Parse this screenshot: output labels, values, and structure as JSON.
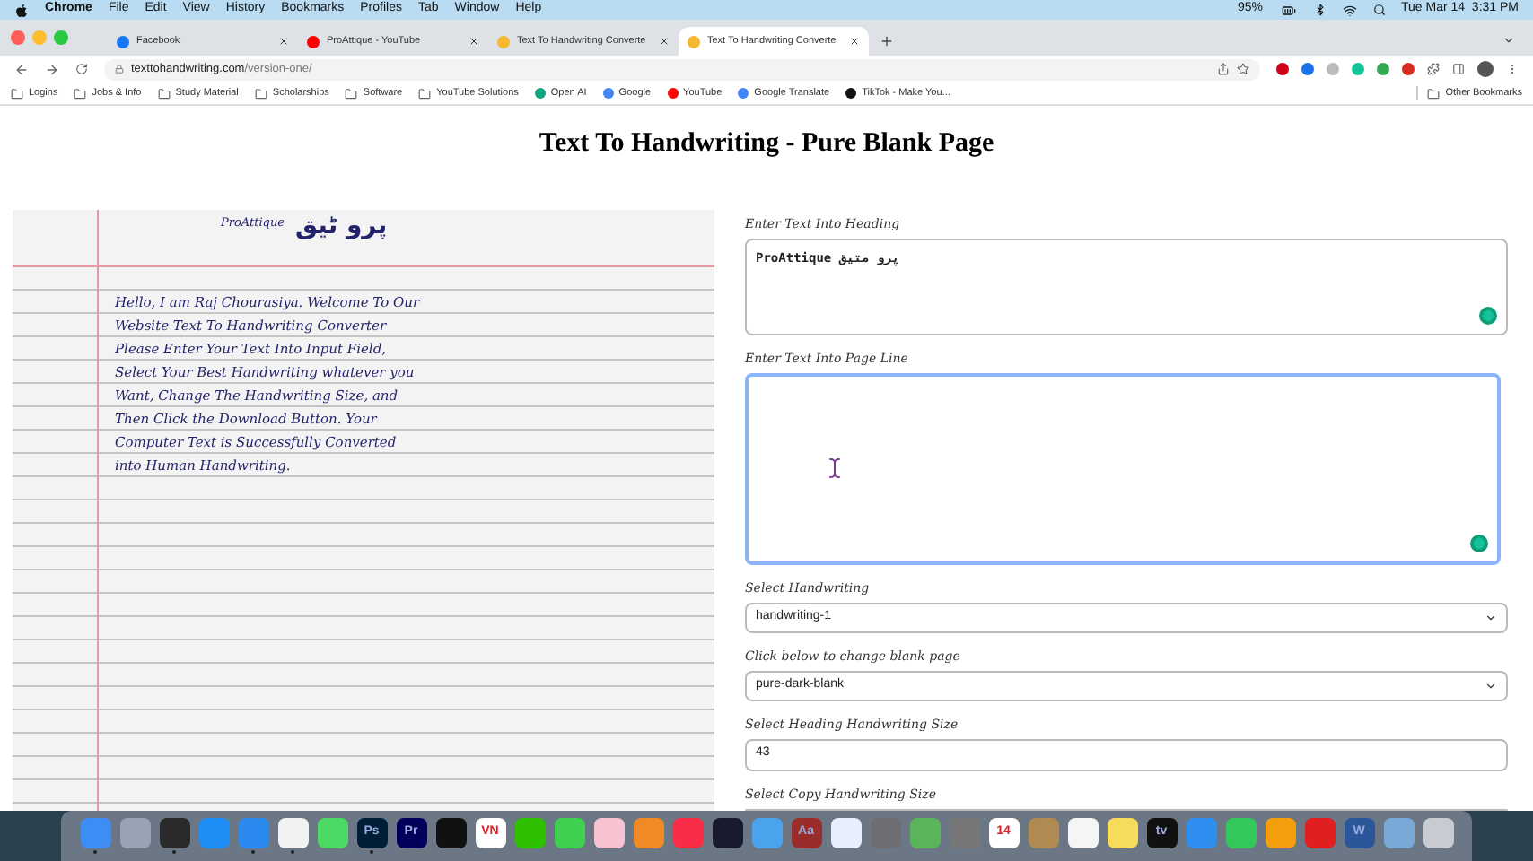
{
  "menu_bar": {
    "app": "Chrome",
    "items": [
      "File",
      "Edit",
      "View",
      "History",
      "Bookmarks",
      "Profiles",
      "Tab",
      "Window",
      "Help"
    ],
    "battery": "95%",
    "clock": "Tue Mar 14  3:31 PM"
  },
  "tabs": [
    {
      "title": "Facebook",
      "selected": false,
      "color": "#1877f2"
    },
    {
      "title": "ProAttique - YouTube",
      "selected": false,
      "color": "#ff0000"
    },
    {
      "title": "Text To Handwriting Converte",
      "selected": false,
      "color": "#f5b82e"
    },
    {
      "title": "Text To Handwriting Converte",
      "selected": true,
      "color": "#f5b82e"
    }
  ],
  "address": {
    "host": "texttohandwriting.com",
    "path": "/version-one/"
  },
  "bookmarks": [
    {
      "label": "Logins",
      "kind": "folder"
    },
    {
      "label": "Jobs & Info",
      "kind": "folder"
    },
    {
      "label": "Study Material",
      "kind": "folder"
    },
    {
      "label": "Scholarships",
      "kind": "folder"
    },
    {
      "label": "Software",
      "kind": "folder"
    },
    {
      "label": "YouTube Solutions",
      "kind": "folder"
    },
    {
      "label": "Open AI",
      "kind": "site",
      "color": "#10a37f"
    },
    {
      "label": "Google",
      "kind": "site",
      "color": "#4285f4"
    },
    {
      "label": "YouTube",
      "kind": "site",
      "color": "#ff0000"
    },
    {
      "label": "Google Translate",
      "kind": "site",
      "color": "#4285f4"
    },
    {
      "label": "TikTok - Make You...",
      "kind": "site",
      "color": "#111111"
    }
  ],
  "other_bookmarks": "Other Bookmarks",
  "page": {
    "heading": "Text To Handwriting - Pure Blank Page",
    "paper": {
      "heading_latin": "ProAttique",
      "heading_urdu": "پرو ٹیق",
      "lines": [
        "Hello, I am Raj Chourasiya. Welcome To Our",
        "Website Text To Handwriting Converter",
        "Please Enter Your Text Into Input Field,",
        "Select Your Best Handwriting whatever you",
        "Want, Change The Handwriting Size, and",
        "Then Click the Download Button. Your",
        "Computer Text is Successfully Converted",
        "into Human Handwriting."
      ]
    },
    "fields": [
      {
        "label": "Enter Text Into Heading",
        "kind": "textarea",
        "value": "ProAttique پرو متیق",
        "focused": false
      },
      {
        "label": "Enter Text Into Page Line",
        "kind": "textarea",
        "focused": true
      },
      {
        "label": "Select Handwriting",
        "kind": "select",
        "value": "handwriting-1"
      },
      {
        "label": "Click below to change blank page",
        "kind": "select",
        "value": "pure-dark-blank"
      },
      {
        "label": "Select Heading Handwriting Size",
        "kind": "input",
        "value": "43"
      },
      {
        "label": "Select Copy Handwriting Size",
        "kind": "input"
      }
    ]
  },
  "dock": [
    {
      "color": "#3d8df5",
      "running": true
    },
    {
      "color": "#9aa3b5",
      "running": false
    },
    {
      "color": "#2a2a2a",
      "running": true
    },
    {
      "color": "#1e8ef5",
      "running": false
    },
    {
      "color": "#2b8af0",
      "running": true
    },
    {
      "color": "#f2f2f2",
      "running": true
    },
    {
      "color": "#4cd964",
      "running": false
    },
    {
      "label": "Ps",
      "color": "#001e36",
      "running": true
    },
    {
      "label": "Pr",
      "color": "#00005b",
      "running": false
    },
    {
      "color": "#111111",
      "running": false
    },
    {
      "label": "VN",
      "color": "#ffffff",
      "running": false
    },
    {
      "color": "#2dc100",
      "running": false
    },
    {
      "color": "#3fd04f",
      "running": false
    },
    {
      "color": "#f7c3d0",
      "running": false
    },
    {
      "color": "#f08a24",
      "running": false
    },
    {
      "color": "#fa2d48",
      "running": false
    },
    {
      "color": "#1a1a2e",
      "running": false
    },
    {
      "color": "#4aa3ec",
      "running": false
    },
    {
      "label": "Aa",
      "color": "#9b2c2c",
      "running": false
    },
    {
      "color": "#e8eefc",
      "running": false
    },
    {
      "color": "#6d6d72",
      "running": false
    },
    {
      "color": "#5ab55a",
      "running": false
    },
    {
      "color": "#777777",
      "running": false
    },
    {
      "label": "14",
      "color": "#ffffff",
      "running": false
    },
    {
      "color": "#b08a50",
      "running": false
    },
    {
      "color": "#f5f5f5",
      "running": false
    },
    {
      "color": "#f7dc5c",
      "running": false
    },
    {
      "label": "tv",
      "color": "#111111",
      "running": false
    },
    {
      "color": "#2f8ff0",
      "running": false
    },
    {
      "color": "#34c759",
      "running": false
    },
    {
      "color": "#f59e0b",
      "running": false
    },
    {
      "color": "#e02020",
      "running": false
    },
    {
      "label": "W",
      "color": "#2b579a",
      "running": false
    },
    {
      "color": "#7aa9d8",
      "running": false
    },
    {
      "color": "#c8ccd2",
      "running": false
    }
  ]
}
